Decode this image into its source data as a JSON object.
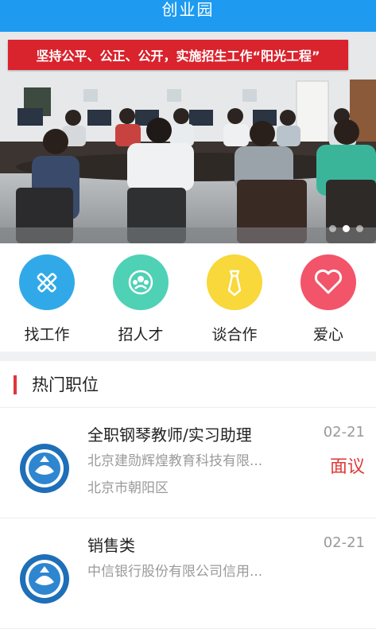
{
  "header": {
    "title": "创业园"
  },
  "banner": {
    "slogan": "坚持公平、公正、公开，实施招生工作“阳光工程”",
    "slide_count": 3,
    "active_slide": 2
  },
  "quick_actions": [
    {
      "label": "找工作",
      "icon": "pencil-ruler-icon",
      "color": "#31a9e8"
    },
    {
      "label": "招人才",
      "icon": "people-group-icon",
      "color": "#4fd1b6"
    },
    {
      "label": "谈合作",
      "icon": "tie-icon",
      "color": "#f8d83a"
    },
    {
      "label": "爱心",
      "icon": "heart-icon",
      "color": "#f2546a"
    }
  ],
  "section": {
    "title": "热门职位"
  },
  "jobs": [
    {
      "title": "全职钢琴教师/实习助理",
      "company": "北京建勋辉煌教育科技有限...",
      "location": "北京市朝阳区",
      "date": "02-21",
      "salary": "面议"
    },
    {
      "title": "销售类",
      "company": "中信银行股份有限公司信用...",
      "location": "",
      "date": "02-21",
      "salary": ""
    }
  ]
}
